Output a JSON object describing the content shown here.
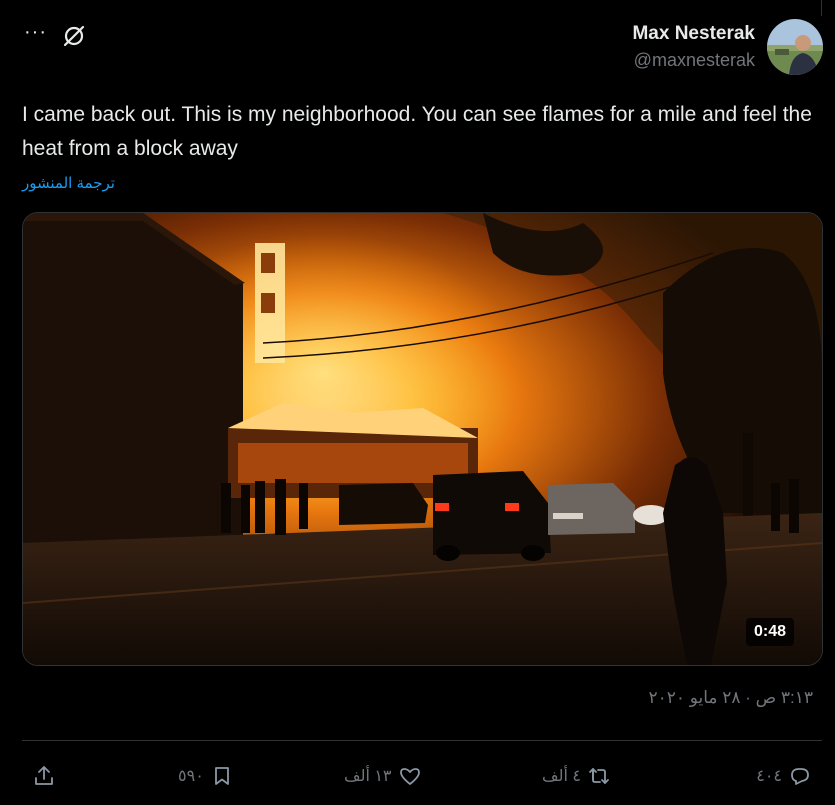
{
  "author": {
    "display_name": "Max Nesterak",
    "handle": "@maxnesterak"
  },
  "tweet": {
    "text": "I came back out. This is my neighborhood. You can see flames for a mile and feel the heat from a block away",
    "translate_label": "ترجمة المنشور",
    "timestamp": "٣:١٣ ص · ٢٨ مايو ٢٠٢٠"
  },
  "media": {
    "duration": "0:48"
  },
  "actions": {
    "replies": "٤٠٤",
    "retweets": "٤ ألف",
    "likes": "١٣ ألف",
    "bookmarks": "٥٩٠"
  },
  "icons": {
    "more": "more-horizontal-icon",
    "grok": "grok-icon",
    "reply": "reply-icon",
    "retweet": "retweet-icon",
    "like": "heart-icon",
    "bookmark": "bookmark-icon",
    "share": "share-icon"
  },
  "colors": {
    "background": "#000000",
    "text": "#e7e9ea",
    "secondary": "#71767b",
    "link": "#1d9bf0",
    "divider": "#2f3336"
  }
}
